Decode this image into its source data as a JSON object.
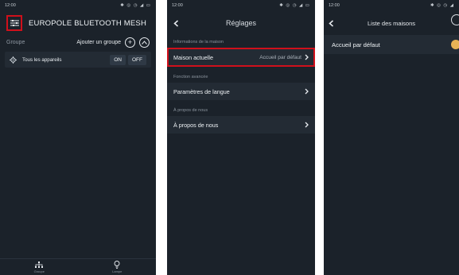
{
  "panel1": {
    "status_time": "12:00",
    "status_icons": "✱ ◎ ◷ ◢ ▭",
    "title": "EUROPOLE BLUETOOTH MESH",
    "group_label": "Groupe",
    "add_group_label": "Ajouter un groupe",
    "device_label": "Tous les appareils",
    "on_label": "ON",
    "off_label": "OFF",
    "tabs": [
      {
        "label": "Groupe",
        "icon": "group-icon"
      },
      {
        "label": "Lampe",
        "icon": "bulb-icon"
      }
    ]
  },
  "panel2": {
    "status_time": "12:00",
    "status_icons": "✱ ◎ ◷ ◢ ▭",
    "title": "Réglages",
    "sections": [
      {
        "label": "Informations de la maison",
        "item": "Maison actuelle",
        "value": "Accueil par défaut"
      },
      {
        "label": "Fonction avancée",
        "item": "Paramètres de langue",
        "value": ""
      },
      {
        "label": "À propos de nous",
        "item": "À propos de nous",
        "value": ""
      }
    ]
  },
  "panel3": {
    "status_time": "12:00",
    "status_icons": "✱ ◎ ◷ ◢",
    "title": "Liste des maisons",
    "house_label": "Accueil par défaut"
  },
  "colors": {
    "background": "#1b222a",
    "row": "#232b34",
    "highlight": "#d0101b",
    "accent": "#e8b357"
  }
}
